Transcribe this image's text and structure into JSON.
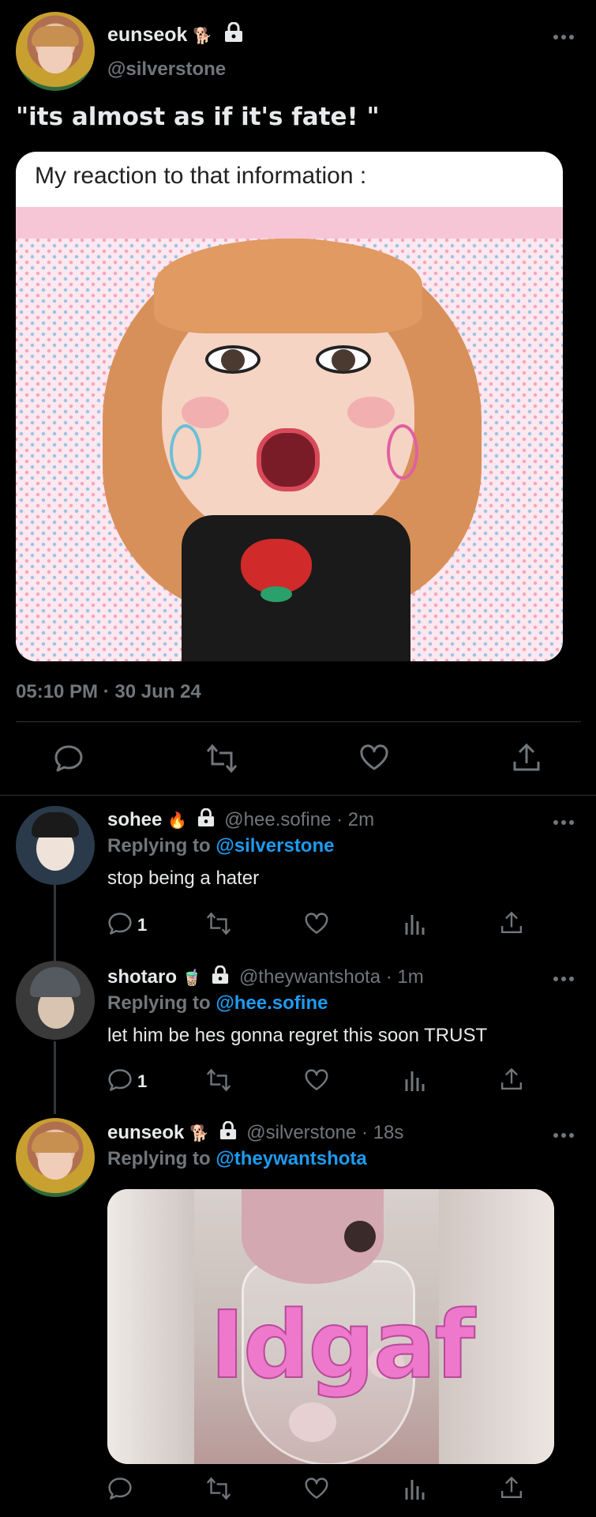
{
  "main_tweet": {
    "display_name": "eunseok",
    "name_emoji": "🐕",
    "handle": "@silverstone",
    "text": "\"its almost as if it's fate! \"",
    "media_caption": "My reaction to that information :",
    "timestamp": "05:10 PM · 30 Jun 24",
    "colors": {
      "bg": "#000000",
      "text": "#e7e9ea",
      "muted": "#71767b",
      "link": "#1d9bf0"
    }
  },
  "replies": [
    {
      "display_name": "sohee",
      "name_emoji": "🔥",
      "handle": "@hee.sofine",
      "time": "· 2m",
      "replying_label": "Replying to",
      "replying_to": "@silverstone",
      "text": "stop being a hater",
      "reply_count": "1"
    },
    {
      "display_name": "shotaro",
      "name_emoji": "🧋",
      "handle": "@theywantshota",
      "time": "· 1m",
      "replying_label": "Replying to",
      "replying_to": "@hee.sofine",
      "text": "let him be hes gonna regret this soon TRUST",
      "reply_count": "1"
    },
    {
      "display_name": "eunseok",
      "name_emoji": "🐕",
      "handle": "@silverstone",
      "time": "· 18s",
      "replying_label": "Replying to",
      "replying_to": "@theywantshota",
      "media_text": "Idgaf"
    }
  ],
  "icons": [
    "more-icon",
    "lock-icon",
    "reply-icon",
    "retweet-icon",
    "like-icon",
    "views-icon",
    "share-icon"
  ]
}
